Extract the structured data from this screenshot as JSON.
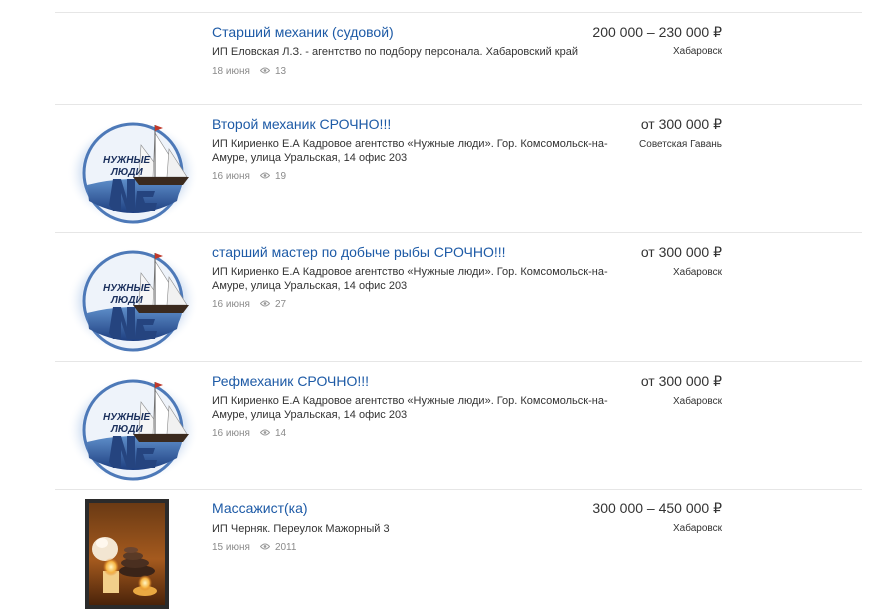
{
  "listings": [
    {
      "title": "Старший механик (судовой)",
      "company": "ИП Еловская Л.З. - агентство по подбору персонала. Хабаровский край",
      "date": "18 июня",
      "views": "13",
      "price": "200 000 – 230 000 ₽",
      "city": "Хабаровск",
      "image": "none"
    },
    {
      "title": "Второй механик СРОЧНО!!!",
      "company": "ИП Кириенко Е.А Кадровое агентство «Нужные люди». Гор. Комсомольск-на-Амуре, улица Уральская, 14 офис 203",
      "date": "16 июня",
      "views": "19",
      "price": "от 300 000 ₽",
      "city": "Советская Гавань",
      "image": "company-logo"
    },
    {
      "title": "старший мастер по добыче рыбы СРОЧНО!!!",
      "company": "ИП Кириенко Е.А Кадровое агентство «Нужные люди». Гор. Комсомольск-на-Амуре, улица Уральская, 14 офис 203",
      "date": "16 июня",
      "views": "27",
      "price": "от 300 000 ₽",
      "city": "Хабаровск",
      "image": "company-logo"
    },
    {
      "title": "Рефмеханик СРОЧНО!!!",
      "company": "ИП Кириенко Е.А Кадровое агентство «Нужные люди». Гор. Комсомольск-на-Амуре, улица Уральская, 14 офис 203",
      "date": "16 июня",
      "views": "14",
      "price": "от 300 000 ₽",
      "city": "Хабаровск",
      "image": "company-logo"
    },
    {
      "title": "Массажист(ка)",
      "company": "ИП Черняк. Переулок Мажорный 3",
      "date": "15 июня",
      "views": "2011",
      "price": "300 000 – 450 000 ₽",
      "city": "Хабаровск",
      "image": "spa-candles-photo"
    }
  ],
  "logo_text": [
    "НУЖНЫЕ",
    "ЛЮДИ"
  ],
  "icons": {
    "views": "eye-icon"
  },
  "colors": {
    "link": "#1d5aa6",
    "text": "#333333",
    "meta": "#8a8a8a",
    "divider": "#e6e6e6"
  }
}
